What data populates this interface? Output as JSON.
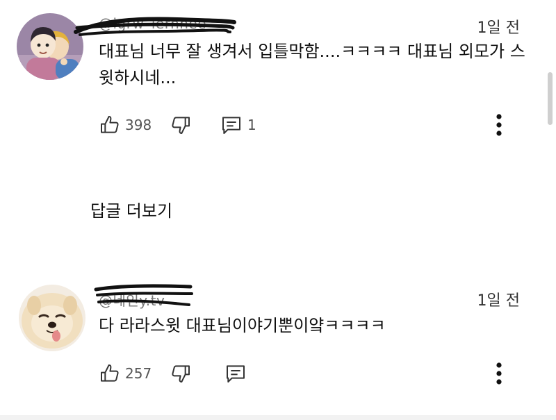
{
  "comments": [
    {
      "handle": "@igrw_lernhee",
      "time": "1일 전",
      "text": "대표님 너무 잘 생겨서 입틀막함....ㅋㅋㅋㅋ 대표님 외모가 스윗하시네...",
      "likes": "398",
      "replies": "1",
      "avatar_icon": "cartoon-avatar-icon"
    },
    {
      "handle": "@네인y.tv",
      "time": "1일 전",
      "text": "다 라라스윗 대표님이야기뿐이얔ㅋㅋㅋㅋ",
      "likes": "257",
      "replies": "",
      "avatar_icon": "pomeranian-avatar-icon"
    }
  ],
  "more_replies_label": "답글 더보기",
  "colors": {
    "text": "#0f0f0f",
    "secondary": "#555555",
    "redaction": "#111111"
  }
}
